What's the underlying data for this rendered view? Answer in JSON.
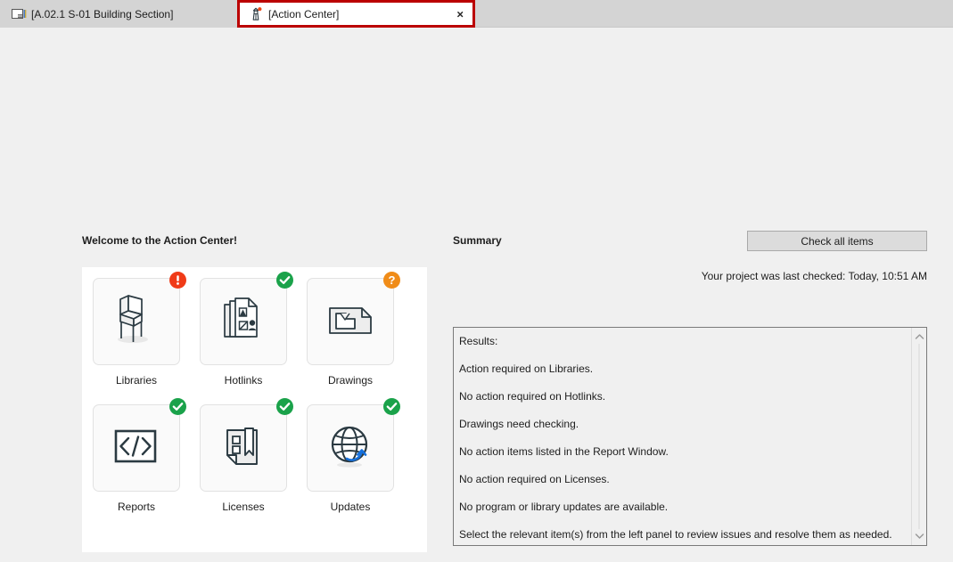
{
  "window": {
    "tabs": [
      {
        "label": "[A.02.1 S-01 Building Section]",
        "icon": "section-view-icon",
        "active": false,
        "has_close": false,
        "has_dot": false
      },
      {
        "label": "[Action Center]",
        "icon": "action-center-tower-icon",
        "active": true,
        "has_close": true,
        "close_label": "×",
        "has_dot": true,
        "dot_color": "#f04a18",
        "highlight_color": "#bb0000"
      }
    ]
  },
  "left_panel": {
    "welcome_title": "Welcome to the Action Center!",
    "tiles": [
      {
        "label": "Libraries",
        "icon": "chair-icon",
        "status": "alert",
        "badge_glyph": "!"
      },
      {
        "label": "Hotlinks",
        "icon": "documents-icon",
        "status": "ok",
        "badge_glyph": "✓"
      },
      {
        "label": "Drawings",
        "icon": "drawing-icon",
        "status": "warn",
        "badge_glyph": "?"
      },
      {
        "label": "Reports",
        "icon": "code-icon",
        "status": "ok",
        "badge_glyph": "✓"
      },
      {
        "label": "Licenses",
        "icon": "license-bookmark-icon",
        "status": "ok",
        "badge_glyph": "✓"
      },
      {
        "label": "Updates",
        "icon": "globe-refresh-icon",
        "status": "ok",
        "badge_glyph": "✓"
      }
    ],
    "status_colors": {
      "ok": "#1aa24a",
      "alert": "#f03b18",
      "warn": "#f08c18"
    }
  },
  "right_panel": {
    "summary_title": "Summary",
    "check_all_label": "Check all items",
    "last_checked": "Your project was last checked: Today, 10:51 AM",
    "results": [
      "Results:",
      "Action required on Libraries.",
      "No action required on Hotlinks.",
      "Drawings need checking.",
      "No action items listed in the Report Window.",
      "No action required on Licenses.",
      "No program or library updates are available.",
      "Select the relevant item(s) from the left panel to review issues and resolve them as needed."
    ],
    "scrollbar": {
      "up_icon": "chevron-up-icon",
      "down_icon": "chevron-down-icon"
    }
  }
}
